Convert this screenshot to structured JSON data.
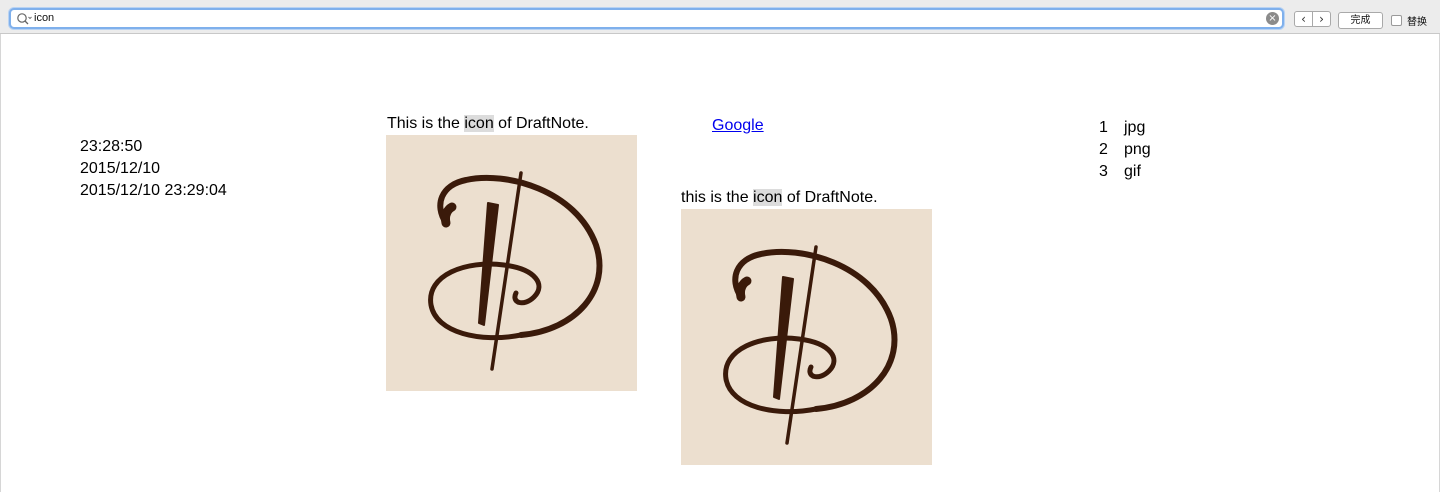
{
  "find_bar": {
    "search_value": "icon",
    "clear_icon": "clear-icon",
    "prev_icon": "chevron-left-icon",
    "next_icon": "chevron-right-icon",
    "done_label": "完成",
    "replace_label": "替换"
  },
  "left_column": {
    "time": "23:28:50",
    "date": "2015/12/10",
    "datetime": "2015/12/10 23:29:04"
  },
  "caption1": {
    "before": "This is the ",
    "match": "icon",
    "after": " of DraftNote."
  },
  "link": {
    "label": "Google"
  },
  "caption2": {
    "before": "this is the ",
    "match": "icon",
    "after": " of DraftNote."
  },
  "list": [
    {
      "num": "1",
      "label": "jpg"
    },
    {
      "num": "2",
      "label": "png"
    },
    {
      "num": "3",
      "label": "gif"
    }
  ],
  "colors": {
    "icon_bg": "#ecdfcf",
    "icon_ink": "#3a1a0a",
    "highlight": "#dcdcdc",
    "link": "#0000ee"
  }
}
